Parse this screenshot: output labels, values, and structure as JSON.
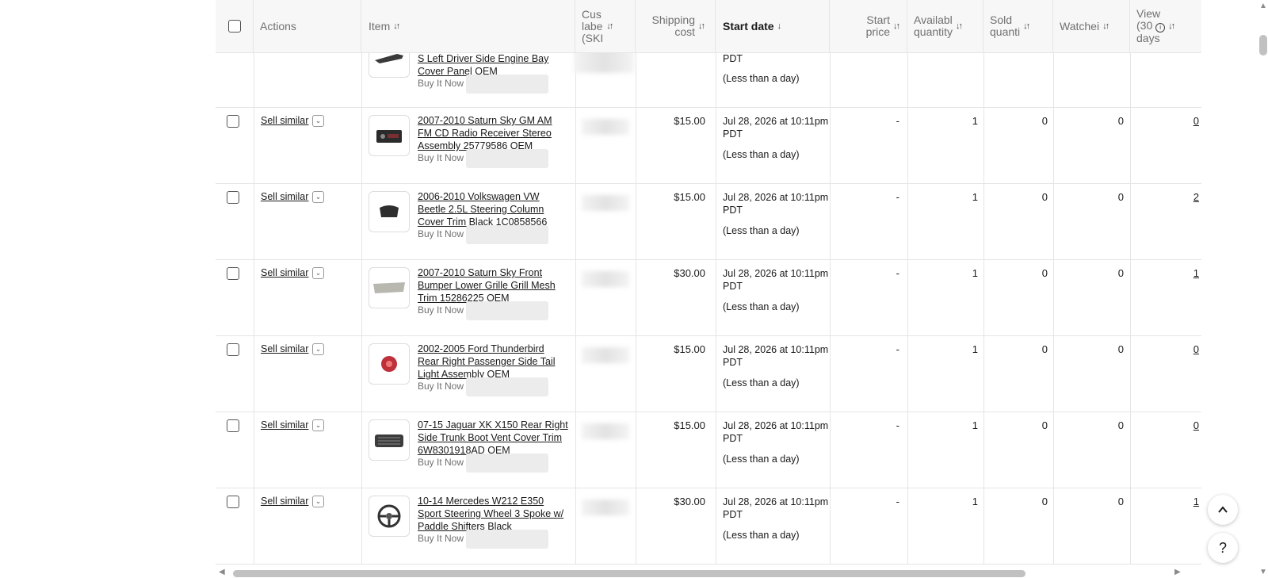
{
  "header": {
    "actions": "Actions",
    "item": "Item",
    "custom_label_l1": "Cus",
    "custom_label_l2": "labe",
    "custom_label_l3": "(SKI",
    "shipping_l1": "Shipping",
    "shipping_l2": "cost",
    "start_date": "Start date",
    "start_price_l1": "Start",
    "start_price_l2": "price",
    "available_l1": "Availabl",
    "available_l2": "quantity",
    "sold_l1": "Sold",
    "sold_l2": "quanti",
    "watchers": "Watchei",
    "views_l1": "View",
    "views_l2": "(30",
    "views_l3": "days",
    "sort_glyph": "↓↑",
    "desc_glyph": "↓"
  },
  "partial_row": {
    "title": "S Left Driver Side Engine Bay Cover Panel OEM",
    "format": "Buy It Now",
    "date_l2": "PDT",
    "date_note": "(Less than a day)"
  },
  "rows": [
    {
      "action": "Sell similar",
      "title": "2007-2010 Saturn Sky GM AM FM CD Radio Receiver Stereo Assembly 25779586 OEM",
      "format": "Buy It Now",
      "shipping": "$15.00",
      "date_l1": "Jul 28, 2026 at 10:11pm",
      "date_l2": "PDT",
      "date_note": "(Less than a day)",
      "start_price": "-",
      "available": "1",
      "sold": "0",
      "watchers": "0",
      "views": "0"
    },
    {
      "action": "Sell similar",
      "title": "2006-2010 Volkswagen VW Beetle 2.5L Steering Column Cover Trim Black 1C0858566",
      "format": "Buy It Now",
      "shipping": "$15.00",
      "date_l1": "Jul 28, 2026 at 10:11pm",
      "date_l2": "PDT",
      "date_note": "(Less than a day)",
      "start_price": "-",
      "available": "1",
      "sold": "0",
      "watchers": "0",
      "views": "2"
    },
    {
      "action": "Sell similar",
      "title": "2007-2010 Saturn Sky Front Bumper Lower Grille Grill Mesh Trim 15286225 OEM",
      "format": "Buy It Now",
      "shipping": "$30.00",
      "date_l1": "Jul 28, 2026 at 10:11pm",
      "date_l2": "PDT",
      "date_note": "(Less than a day)",
      "start_price": "-",
      "available": "1",
      "sold": "0",
      "watchers": "0",
      "views": "1"
    },
    {
      "action": "Sell similar",
      "title": "2002-2005 Ford Thunderbird Rear Right Passenger Side Tail Light Assembly OEM",
      "format": "Buy It Now",
      "shipping": "$15.00",
      "date_l1": "Jul 28, 2026 at 10:11pm",
      "date_l2": "PDT",
      "date_note": "(Less than a day)",
      "start_price": "-",
      "available": "1",
      "sold": "0",
      "watchers": "0",
      "views": "0"
    },
    {
      "action": "Sell similar",
      "title": "07-15 Jaguar XK X150 Rear Right Side Trunk Boot Vent Cover Trim 6W8301918AD OEM",
      "format": "Buy It Now",
      "shipping": "$15.00",
      "date_l1": "Jul 28, 2026 at 10:11pm",
      "date_l2": "PDT",
      "date_note": "(Less than a day)",
      "start_price": "-",
      "available": "1",
      "sold": "0",
      "watchers": "0",
      "views": "0"
    },
    {
      "action": "Sell similar",
      "title": "10-14 Mercedes W212 E350 Sport Steering Wheel 3 Spoke w/ Paddle Shifters Black",
      "format": "Buy It Now",
      "shipping": "$30.00",
      "date_l1": "Jul 28, 2026 at 10:11pm",
      "date_l2": "PDT",
      "date_note": "(Less than a day)",
      "start_price": "-",
      "available": "1",
      "sold": "0",
      "watchers": "0",
      "views": "1"
    }
  ],
  "controls": {
    "scroll_top_glyph": "⌃",
    "help_glyph": "?"
  }
}
